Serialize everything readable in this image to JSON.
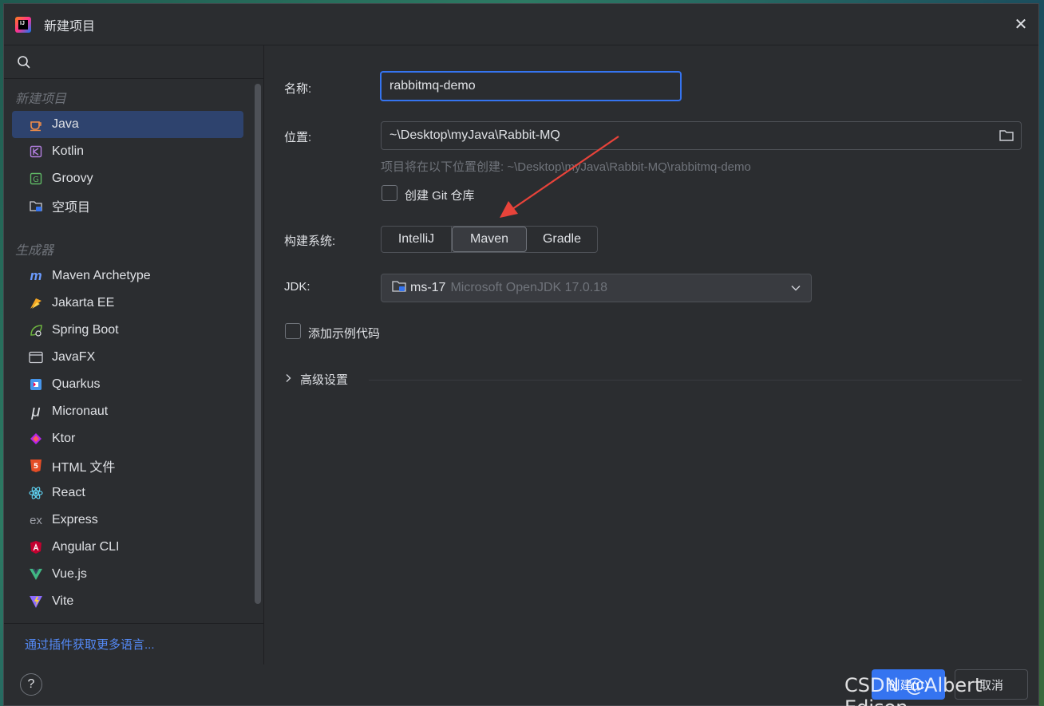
{
  "window": {
    "title": "新建项目"
  },
  "sidebar": {
    "search_placeholder": "",
    "section_new": "新建项目",
    "new_items": [
      {
        "label": "Java",
        "icon": "java-cup-icon",
        "selected": true
      },
      {
        "label": "Kotlin",
        "icon": "kotlin-icon"
      },
      {
        "label": "Groovy",
        "icon": "groovy-icon"
      },
      {
        "label": "空项目",
        "icon": "empty-project-icon"
      }
    ],
    "section_generators": "生成器",
    "generator_items": [
      {
        "label": "Maven Archetype",
        "icon": "maven-icon"
      },
      {
        "label": "Jakarta EE",
        "icon": "jakarta-icon"
      },
      {
        "label": "Spring Boot",
        "icon": "spring-icon"
      },
      {
        "label": "JavaFX",
        "icon": "javafx-icon"
      },
      {
        "label": "Quarkus",
        "icon": "quarkus-icon"
      },
      {
        "label": "Micronaut",
        "icon": "micronaut-icon"
      },
      {
        "label": "Ktor",
        "icon": "ktor-icon"
      },
      {
        "label": "HTML 文件",
        "icon": "html5-icon"
      },
      {
        "label": "React",
        "icon": "react-icon"
      },
      {
        "label": "Express",
        "icon": "express-icon"
      },
      {
        "label": "Angular CLI",
        "icon": "angular-icon"
      },
      {
        "label": "Vue.js",
        "icon": "vue-icon"
      },
      {
        "label": "Vite",
        "icon": "vite-icon"
      }
    ],
    "more_link": "通过插件获取更多语言..."
  },
  "form": {
    "name_label": "名称:",
    "name_value": "rabbitmq-demo",
    "location_label": "位置:",
    "location_value": "~\\Desktop\\myJava\\Rabbit-MQ",
    "location_hint": "项目将在以下位置创建: ~\\Desktop\\myJava\\Rabbit-MQ\\rabbitmq-demo",
    "git_label": "创建 Git 仓库",
    "build_label": "构建系统:",
    "build_options": [
      "IntelliJ",
      "Maven",
      "Gradle"
    ],
    "build_selected": "Maven",
    "jdk_label": "JDK:",
    "jdk_name": "ms-17",
    "jdk_detail": "Microsoft OpenJDK 17.0.18",
    "sample_label": "添加示例代码",
    "advanced_label": "高级设置"
  },
  "footer": {
    "help": "?",
    "create": "创建(C)",
    "cancel": "取消"
  },
  "watermark": "CSDN @Albert Edison",
  "colors": {
    "accent": "#3574f0",
    "arrow": "#e8433a"
  }
}
